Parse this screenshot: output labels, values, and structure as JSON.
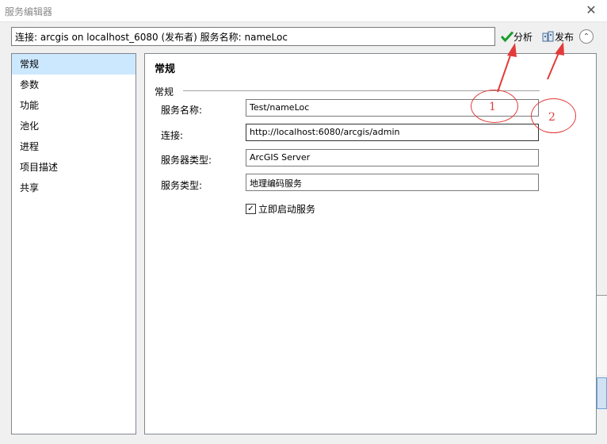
{
  "window": {
    "title": "服务编辑器",
    "close_glyph": "✕"
  },
  "toolbar": {
    "connection_text": "连接: arcgis on localhost_6080 (发布者)    服务名称: nameLoc",
    "analyze_label": "分析",
    "publish_label": "发布",
    "collapse_glyph": "⌃"
  },
  "sidebar": {
    "items": [
      {
        "label": "常规",
        "selected": true
      },
      {
        "label": "参数"
      },
      {
        "label": "功能"
      },
      {
        "label": "池化"
      },
      {
        "label": "进程"
      },
      {
        "label": "项目描述"
      },
      {
        "label": "共享"
      }
    ]
  },
  "main": {
    "title": "常规",
    "section": "常规",
    "fields": [
      {
        "label": "服务名称:",
        "value": "Test/nameLoc"
      },
      {
        "label": "连接:",
        "value": "http://localhost:6080/arcgis/admin"
      },
      {
        "label": "服务器类型:",
        "value": "ArcGIS Server"
      },
      {
        "label": "服务类型:",
        "value": "地理编码服务"
      }
    ],
    "start_service": {
      "label": "立即启动服务",
      "checked": true,
      "glyph": "✓"
    }
  },
  "annotations": {
    "circle1": "1",
    "circle2": "2",
    "color": "#e23b3b"
  }
}
